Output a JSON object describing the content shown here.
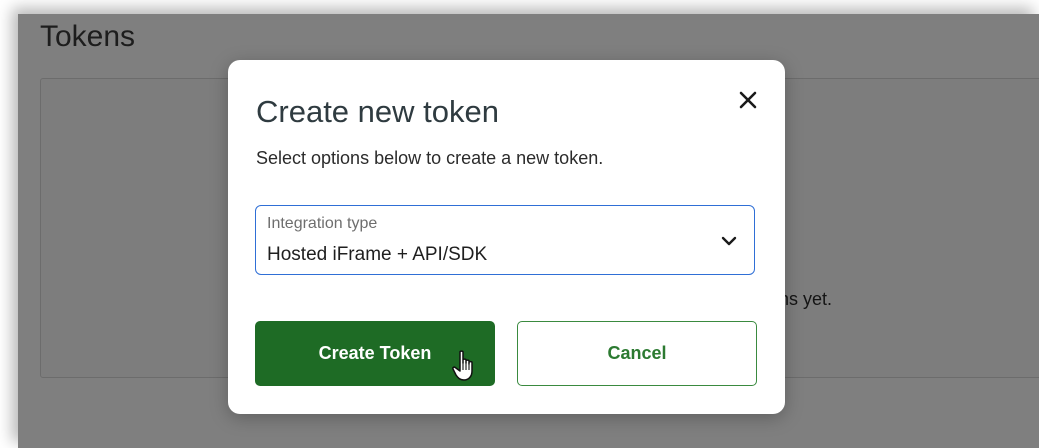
{
  "page": {
    "title": "Tokens",
    "empty_text": "okens yet."
  },
  "modal": {
    "title": "Create new token",
    "subtitle": "Select options below to create a new token.",
    "close_icon": "close-icon",
    "integration_select": {
      "label": "Integration type",
      "value": "Hosted iFrame + API/SDK",
      "icon": "chevron-down-icon"
    },
    "buttons": {
      "create_label": "Create Token",
      "cancel_label": "Cancel"
    }
  },
  "colors": {
    "primary": "#1e6b25",
    "secondary_text": "#2c7a31",
    "focus_border": "#2f6fd6"
  }
}
